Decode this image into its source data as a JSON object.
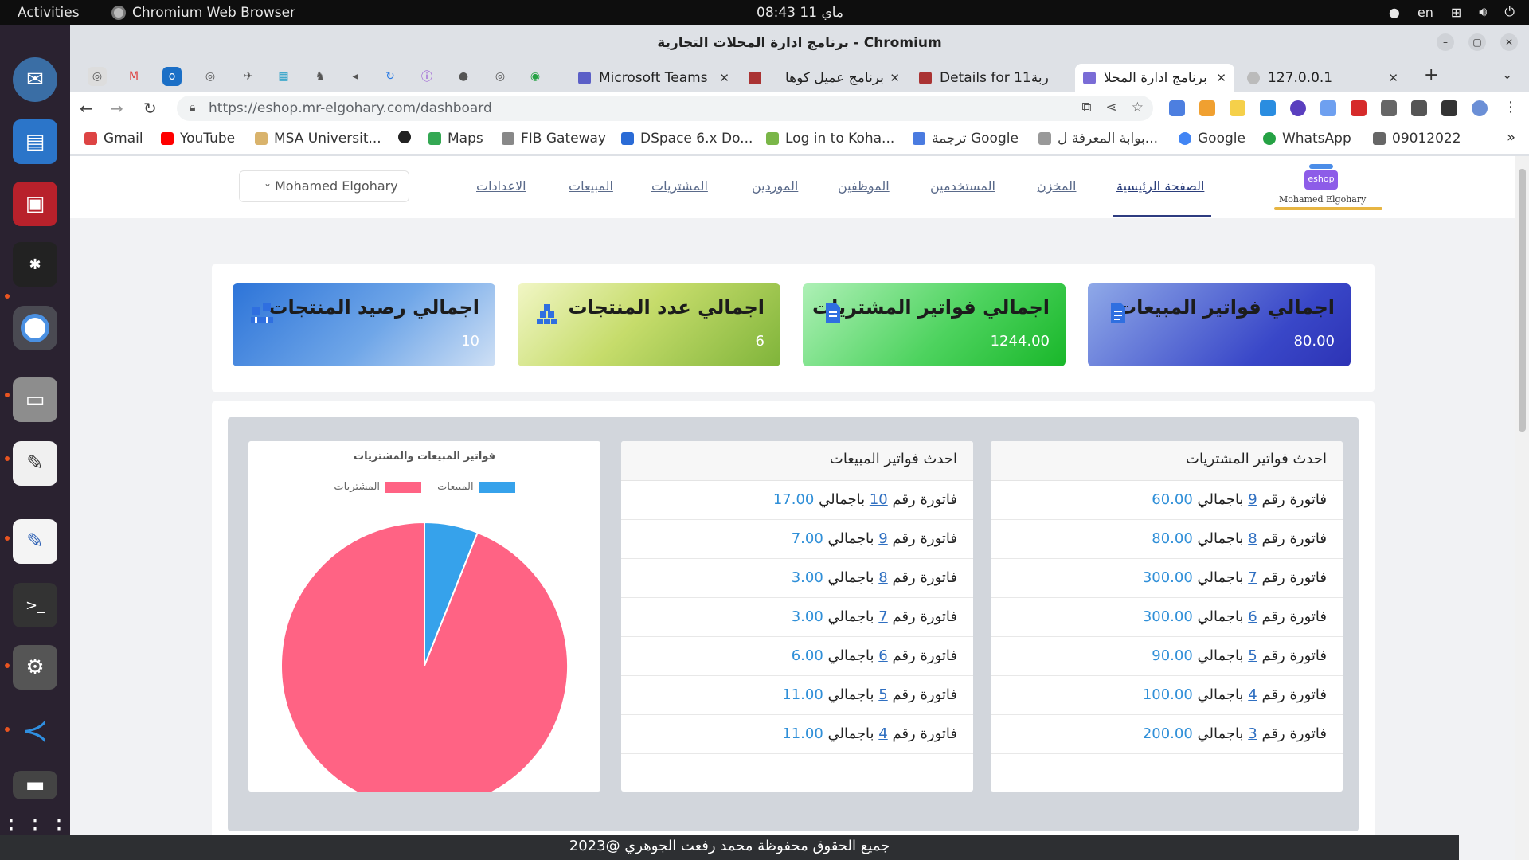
{
  "os": {
    "activities": "Activities",
    "app_name": "Chromium Web Browser",
    "clock": "ماي 11  08:43",
    "lang": "en"
  },
  "browser": {
    "window_title": "برنامج ادارة المحلات التجارية - Chromium",
    "tabs": [
      {
        "title": "Microsoft Teams"
      },
      {
        "title": "برنامج عميل كوها"
      },
      {
        "title": "Details for 11ربة"
      },
      {
        "title": "برنامج ادارة المحلا"
      },
      {
        "title": "127.0.0.1"
      }
    ],
    "new_tab": "+",
    "url": "https://eshop.mr-elgohary.com/dashboard",
    "bookmarks": [
      "Gmail",
      "YouTube",
      "MSA Universit...",
      "Maps",
      "FIB Gateway",
      "DSpace 6.x Do...",
      "Log in to Koha...",
      "ترجمة Google",
      "بوابة المعرفة ل...",
      "Google",
      "WhatsApp",
      "09012022"
    ],
    "more": "»"
  },
  "app": {
    "logo_text": "eshop",
    "logo_caption": "Mohamed Elgohary",
    "nav": [
      "الصفحة الرئيسية",
      "المخزن",
      "المستخدمين",
      "الموظفين",
      "الموردين",
      "المشتريات",
      "المبيعات",
      "الاعدادات"
    ],
    "user": "Mohamed Elgohary"
  },
  "cards": [
    {
      "title": "اجمالي فواتير المبيعات",
      "value": "80.00",
      "icon": "invoice-icon"
    },
    {
      "title": "اجمالي فواتير المشتريات",
      "value": "1244.00",
      "icon": "document-icon"
    },
    {
      "title": "اجمالي عدد المنتجات",
      "value": "6",
      "icon": "boxes-icon"
    },
    {
      "title": "اجمالي رصيد المنتجات",
      "value": "10",
      "icon": "stock-icon"
    }
  ],
  "purchases": {
    "heading": "احدث فواتير المشتريات",
    "prefix": "فاتورة رقم",
    "mid": "باجمالي",
    "rows": [
      {
        "num": "9",
        "total": "60.00"
      },
      {
        "num": "8",
        "total": "80.00"
      },
      {
        "num": "7",
        "total": "300.00"
      },
      {
        "num": "6",
        "total": "300.00"
      },
      {
        "num": "5",
        "total": "90.00"
      },
      {
        "num": "4",
        "total": "100.00"
      },
      {
        "num": "3",
        "total": "200.00"
      }
    ]
  },
  "sales": {
    "heading": "احدث فواتير المبيعات",
    "prefix": "فاتورة رقم",
    "mid": "باجمالي",
    "rows": [
      {
        "num": "10",
        "total": "17.00"
      },
      {
        "num": "9",
        "total": "7.00"
      },
      {
        "num": "8",
        "total": "3.00"
      },
      {
        "num": "7",
        "total": "3.00"
      },
      {
        "num": "6",
        "total": "6.00"
      },
      {
        "num": "5",
        "total": "11.00"
      },
      {
        "num": "4",
        "total": "11.00"
      }
    ]
  },
  "chart_data": {
    "type": "pie",
    "title": "فواتير المبيعات والمشتريات",
    "labels": [
      "المشتريات",
      "المبيعات"
    ],
    "values": [
      1244.0,
      80.0
    ],
    "colors": [
      "#ff6384",
      "#36a2eb"
    ],
    "legend_position": "top"
  },
  "footer": "جميع الحقوق محفوظة محمد رفعت الجوهري @2023"
}
